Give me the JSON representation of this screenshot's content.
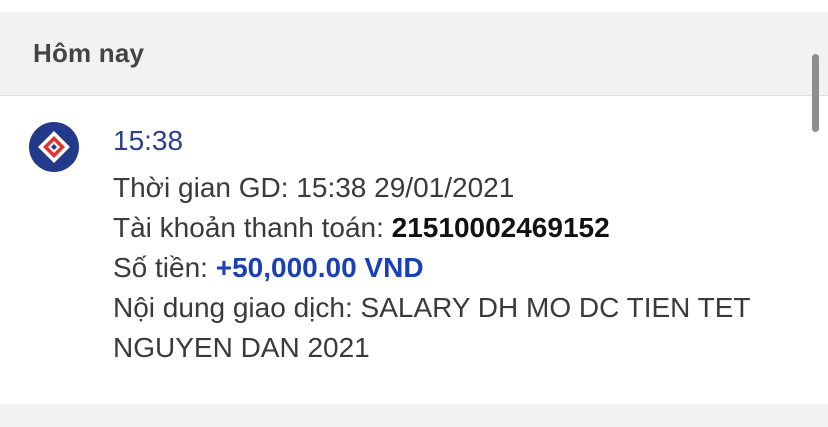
{
  "section": {
    "title": "Hôm nay"
  },
  "notification": {
    "logo_icon": "bidv-diamond-logo-icon",
    "time": "15:38",
    "transaction_time_label": "Thời gian GD: ",
    "transaction_time_value": "15:38 29/01/2021",
    "account_label": "Tài khoản thanh toán: ",
    "account_value": "21510002469152",
    "amount_label": "Số tiền: ",
    "amount_value": "+50,000.00 VND",
    "content_label": "Nội dung giao dịch: ",
    "content_value": "SALARY DH MO DC TIEN TET NGUYEN DAN 2021"
  },
  "colors": {
    "time_blue": "#2b3f8f",
    "amount_blue": "#1a3fb8",
    "logo_red": "#e0322f",
    "logo_navy": "#233a8a",
    "header_bg": "#f2f2f2"
  }
}
